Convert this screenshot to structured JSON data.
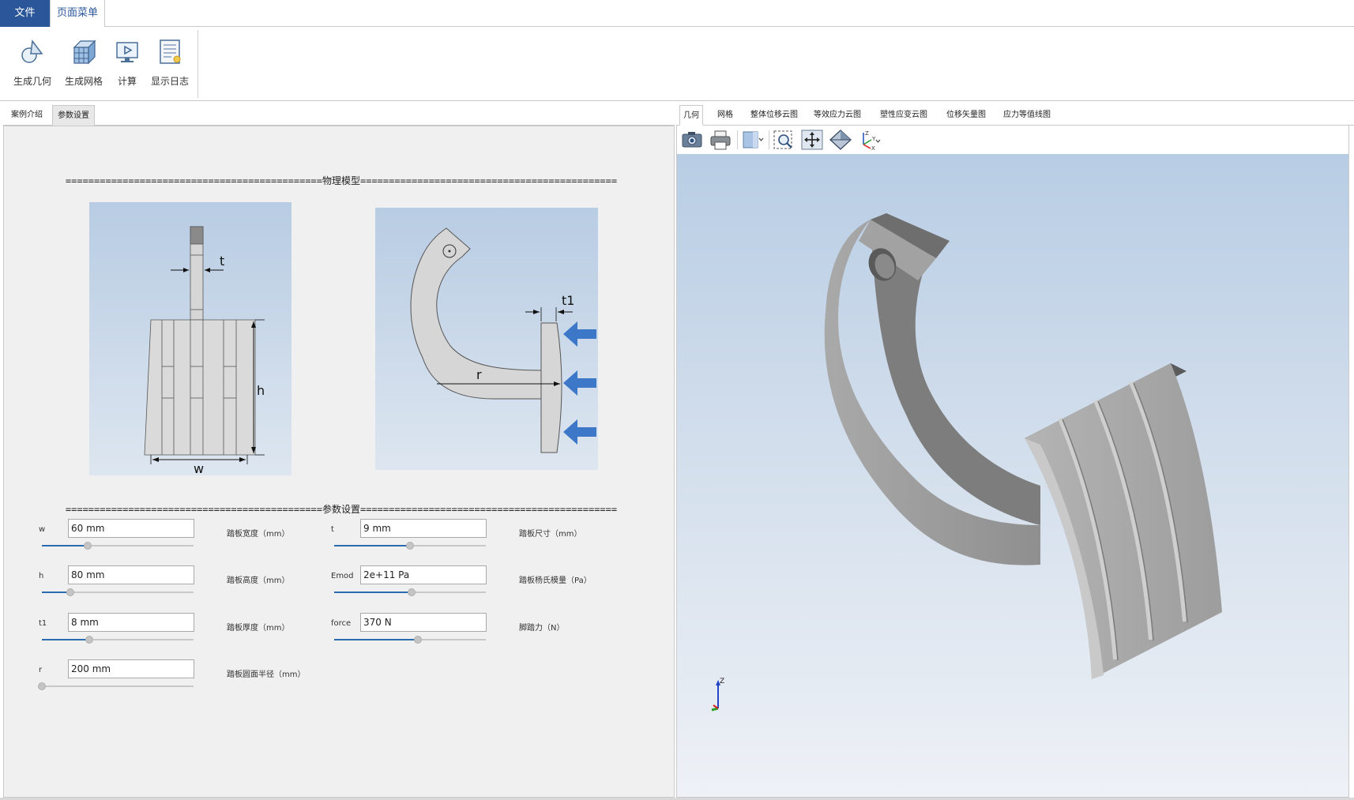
{
  "ribbon": {
    "tabs": [
      "文件",
      "页面菜单"
    ],
    "buttons": [
      {
        "label": "生成几何",
        "icon": "geometry-icon"
      },
      {
        "label": "生成网格",
        "icon": "mesh-icon"
      },
      {
        "label": "计算",
        "icon": "compute-icon"
      },
      {
        "label": "显示日志",
        "icon": "log-icon"
      }
    ]
  },
  "left_tabs": [
    "案例介绍",
    "参数设置"
  ],
  "sections": {
    "model": "=============================================物理模型=============================================",
    "params": "=============================================参数设置============================================="
  },
  "figure_labels": {
    "t": "t",
    "h": "h",
    "w": "w",
    "t1": "t1",
    "r": "r"
  },
  "params": [
    {
      "name": "w",
      "value": "60 mm",
      "desc": "踏板宽度（mm）",
      "slider": 0.3
    },
    {
      "name": "t",
      "value": "9 mm",
      "desc": "踏板尺寸（mm）",
      "slider": 0.5
    },
    {
      "name": "h",
      "value": "80 mm",
      "desc": "踏板高度（mm）",
      "slider": 0.19
    },
    {
      "name": "Emod",
      "value": "2e+11 Pa",
      "desc": "踏板杨氏模量（Pa）",
      "slider": 0.51
    },
    {
      "name": "t1",
      "value": "8 mm",
      "desc": "踏板厚度（mm）",
      "slider": 0.31
    },
    {
      "name": "force",
      "value": "370 N",
      "desc": "脚踏力（N）",
      "slider": 0.55
    },
    {
      "name": "r",
      "value": "200 mm",
      "desc": "踏板圆面半径（mm）",
      "slider": 0.0
    }
  ],
  "viewer_tabs": [
    "几何",
    "网格",
    "整体位移云图",
    "等效应力云图",
    "塑性应变云图",
    "位移矢量图",
    "应力等值线图"
  ],
  "axis_labels": {
    "z": "Z",
    "y": "Y",
    "x": "X"
  },
  "colors": {
    "accent": "#2b579a",
    "slider_fill": "#2b6cb0",
    "force_arrow": "#3d78c8"
  }
}
